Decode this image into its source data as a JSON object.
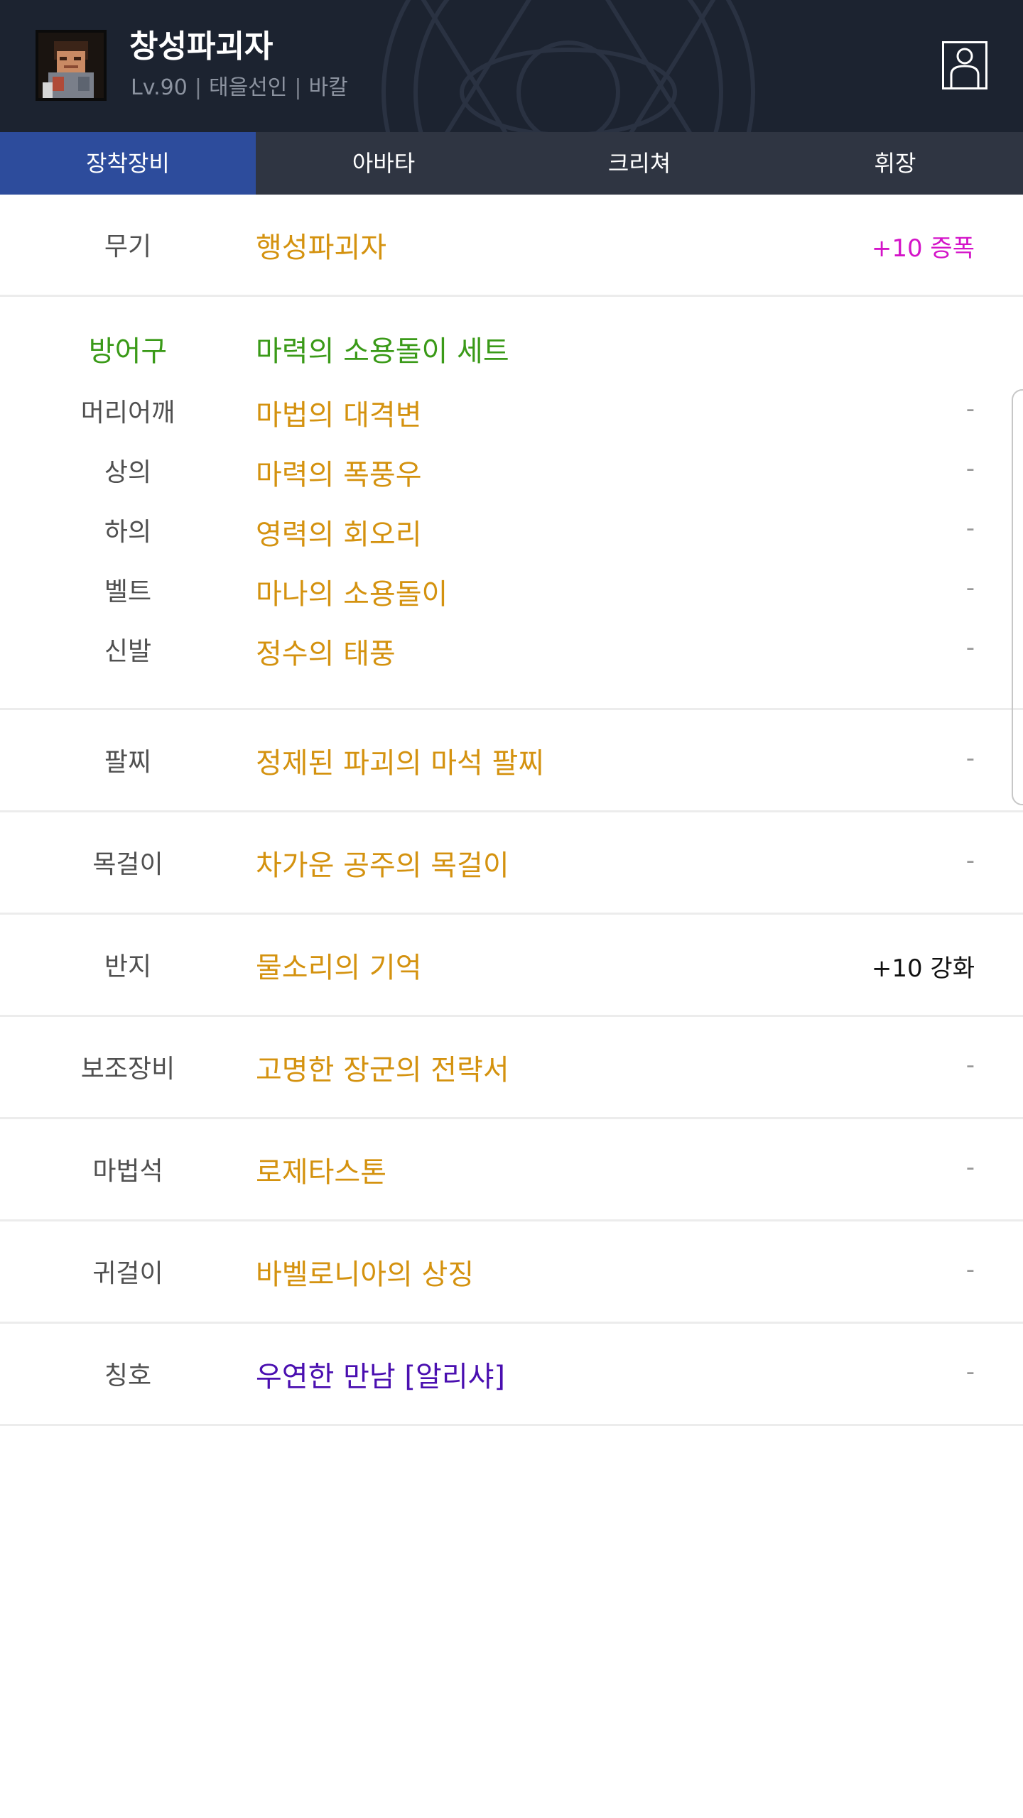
{
  "character": {
    "name": "창성파괴자",
    "level": "Lv.90",
    "guild": "태을선인",
    "server": "바칼",
    "separator": "|"
  },
  "tabs": [
    {
      "label": "장착장비",
      "active": true
    },
    {
      "label": "아바타",
      "active": false
    },
    {
      "label": "크리쳐",
      "active": false
    },
    {
      "label": "휘장",
      "active": false
    }
  ],
  "equipment": {
    "weapon": {
      "slot": "무기",
      "item": "행성파괴자",
      "extra": "+10 증폭"
    },
    "armor": {
      "slot": "방어구",
      "set_name": "마력의 소용돌이 세트",
      "pieces": [
        {
          "slot": "머리어깨",
          "item": "마법의 대격변",
          "extra": "-"
        },
        {
          "slot": "상의",
          "item": "마력의 폭풍우",
          "extra": "-"
        },
        {
          "slot": "하의",
          "item": "영력의 회오리",
          "extra": "-"
        },
        {
          "slot": "벨트",
          "item": "마나의 소용돌이",
          "extra": "-"
        },
        {
          "slot": "신발",
          "item": "정수의 태풍",
          "extra": "-"
        }
      ]
    },
    "bracelet": {
      "slot": "팔찌",
      "item": "정제된 파괴의 마석 팔찌",
      "extra": "-"
    },
    "necklace": {
      "slot": "목걸이",
      "item": "차가운 공주의 목걸이",
      "extra": "-"
    },
    "ring": {
      "slot": "반지",
      "item": "물소리의 기억",
      "extra": "+10 강화"
    },
    "support": {
      "slot": "보조장비",
      "item": "고명한 장군의 전략서",
      "extra": "-"
    },
    "magicstone": {
      "slot": "마법석",
      "item": "로제타스톤",
      "extra": "-"
    },
    "earring": {
      "slot": "귀걸이",
      "item": "바벨로니아의 상징",
      "extra": "-"
    },
    "title": {
      "slot": "칭호",
      "item": "우연한 만남 [알리샤]",
      "extra": "-"
    }
  },
  "colors": {
    "header_bg": "#1c2330",
    "tab_bar": "#2f3542",
    "tab_active": "#2d4c9c",
    "item_epic": "#d4920f",
    "set_green": "#3a9a18",
    "title_purple": "#4a0fb0",
    "amplify_magenta": "#d414c8"
  }
}
